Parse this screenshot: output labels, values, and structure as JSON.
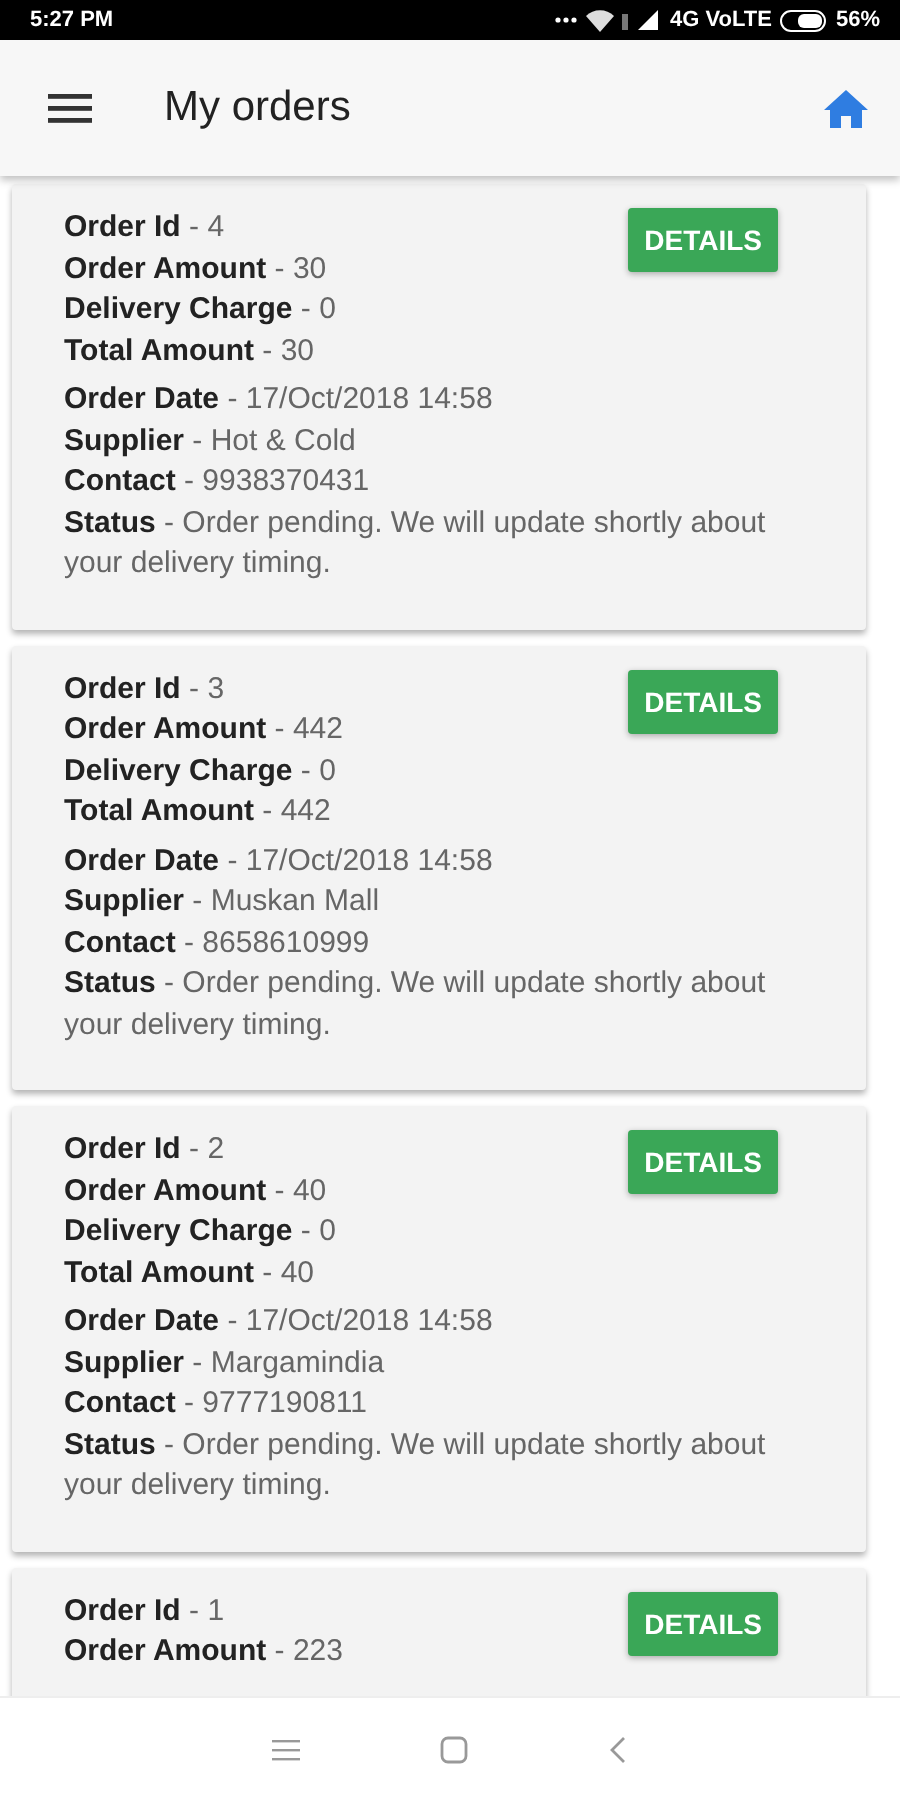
{
  "status_bar": {
    "time": "5:27 PM",
    "network": "4G VoLTE",
    "battery": "56%"
  },
  "app_bar": {
    "title": "My orders"
  },
  "orders": [
    {
      "button": "DETAILS",
      "groups": [
        [
          "**Order Id** - 4",
          "**Order Amount** - 30",
          "**Delivery Charge** - 0",
          "**Total Amount** - 30"
        ],
        [
          "**Order Date** - 17/Oct/2018 14:58",
          "**Supplier** - Hot & Cold",
          "**Contact** - 9938370431",
          "**Status** - Order pending. We will update shortly about your delivery timing."
        ]
      ]
    },
    {
      "button": "DETAILS",
      "groups": [
        [
          "**Order Id** - 3",
          "**Order Amount** - 442",
          "**Delivery Charge** - 0",
          "**Total Amount** - 442"
        ],
        [
          "**Order Date** - 17/Oct/2018 14:58",
          "**Supplier** - Muskan Mall",
          "**Contact** - 8658610999",
          "**Status** - Order pending. We will update shortly about your delivery timing."
        ]
      ]
    },
    {
      "button": "DETAILS",
      "groups": [
        [
          "**Order Id** - 2",
          "**Order Amount** - 40",
          "**Delivery Charge** - 0",
          "**Total Amount** - 40"
        ],
        [
          "**Order Date** - 17/Oct/2018 14:58",
          "**Supplier** - Margamindia",
          "**Contact** - 9777190811",
          "**Status** - Order pending. We will update shortly about your delivery timing."
        ]
      ]
    },
    {
      "button": "DETAILS",
      "groups": [
        [
          "**Order Id** - 1",
          "**Order Amount** - 223"
        ]
      ]
    }
  ]
}
